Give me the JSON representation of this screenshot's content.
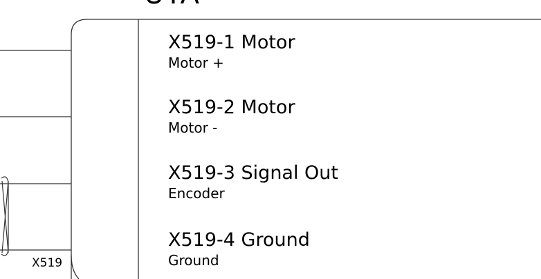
{
  "header_fragment": "UTA",
  "connector_label": "X519",
  "pins": [
    {
      "title": "X519-1 Motor",
      "subtitle": "Motor +"
    },
    {
      "title": "X519-2 Motor",
      "subtitle": "Motor -"
    },
    {
      "title": "X519-3 Signal Out",
      "subtitle": "Encoder"
    },
    {
      "title": "X519-4 Ground",
      "subtitle": "Ground"
    }
  ],
  "colors": {
    "line": "#333333",
    "text": "#000000",
    "background": "#ffffff"
  }
}
